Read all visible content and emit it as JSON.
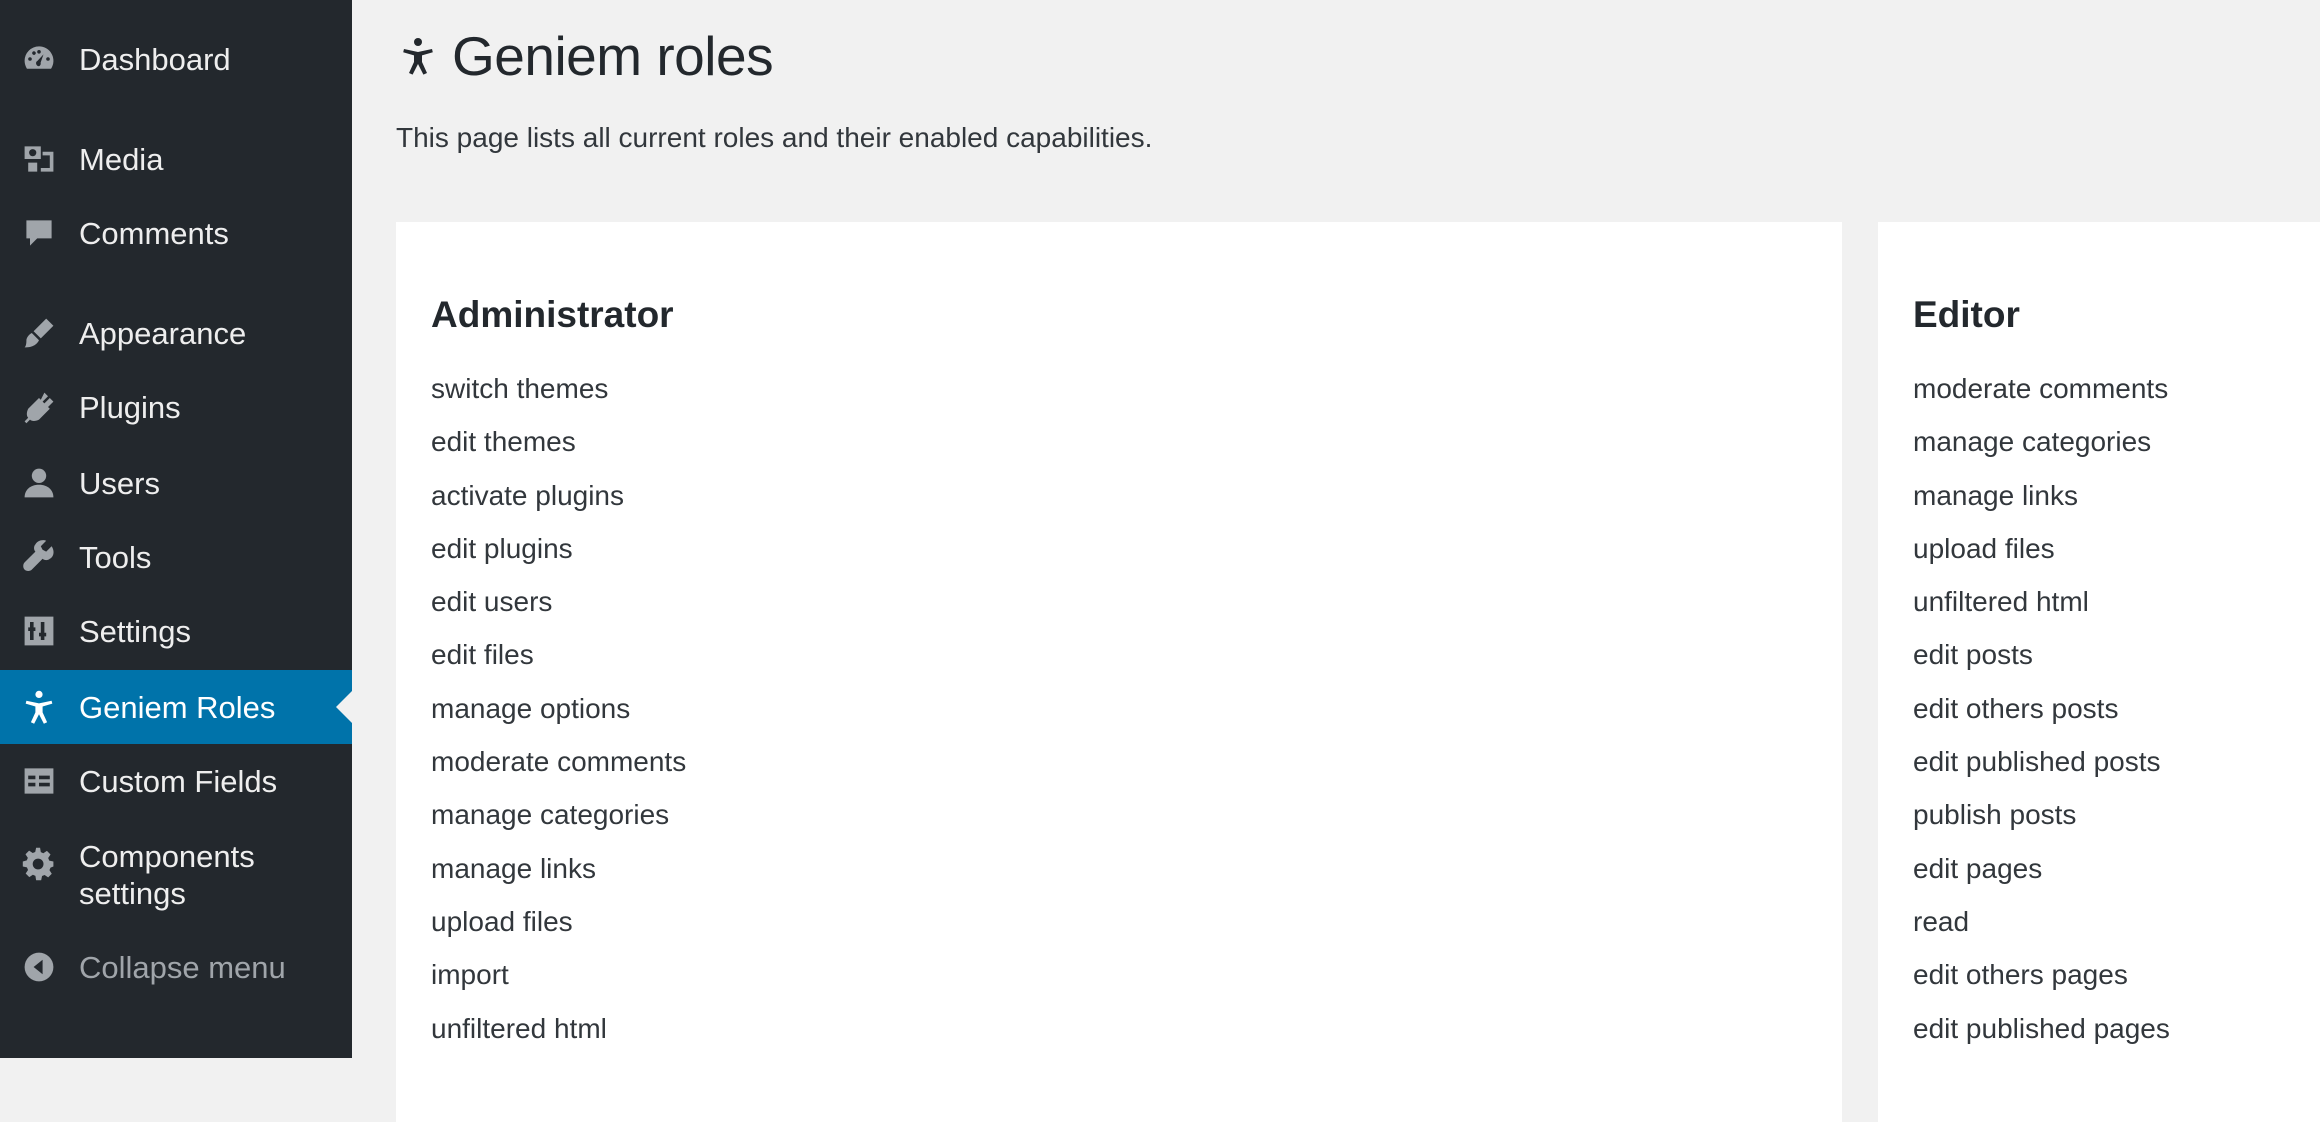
{
  "sidebar": {
    "items": [
      {
        "label": "Dashboard",
        "icon": "dashboard-icon"
      },
      {
        "label": "Media",
        "icon": "media-icon"
      },
      {
        "label": "Comments",
        "icon": "comments-icon"
      },
      {
        "label": "Appearance",
        "icon": "appearance-brush-icon"
      },
      {
        "label": "Plugins",
        "icon": "plugins-icon"
      },
      {
        "label": "Users",
        "icon": "users-icon"
      },
      {
        "label": "Tools",
        "icon": "tools-wrench-icon"
      },
      {
        "label": "Settings",
        "icon": "settings-sliders-icon"
      },
      {
        "label": "Geniem Roles",
        "icon": "universal-access-icon",
        "current": true
      },
      {
        "label": "Custom Fields",
        "icon": "custom-fields-table-icon"
      },
      {
        "label": "Components settings",
        "icon": "gear-icon"
      }
    ],
    "collapse_label": "Collapse menu",
    "colors": {
      "background": "#23282d",
      "current": "#0073aa",
      "icon": "#a0a5aa"
    }
  },
  "page": {
    "title": "Geniem roles",
    "title_icon": "universal-access-icon",
    "description": "This page lists all current roles and their enabled capabilities."
  },
  "roles": [
    {
      "name": "Administrator",
      "capabilities": [
        "switch themes",
        "edit themes",
        "activate plugins",
        "edit plugins",
        "edit users",
        "edit files",
        "manage options",
        "moderate comments",
        "manage categories",
        "manage links",
        "upload files",
        "import",
        "unfiltered html"
      ]
    },
    {
      "name": "Editor",
      "capabilities": [
        "moderate comments",
        "manage categories",
        "manage links",
        "upload files",
        "unfiltered html",
        "edit posts",
        "edit others posts",
        "edit published posts",
        "publish posts",
        "edit pages",
        "read",
        "edit others pages",
        "edit published pages"
      ]
    }
  ]
}
